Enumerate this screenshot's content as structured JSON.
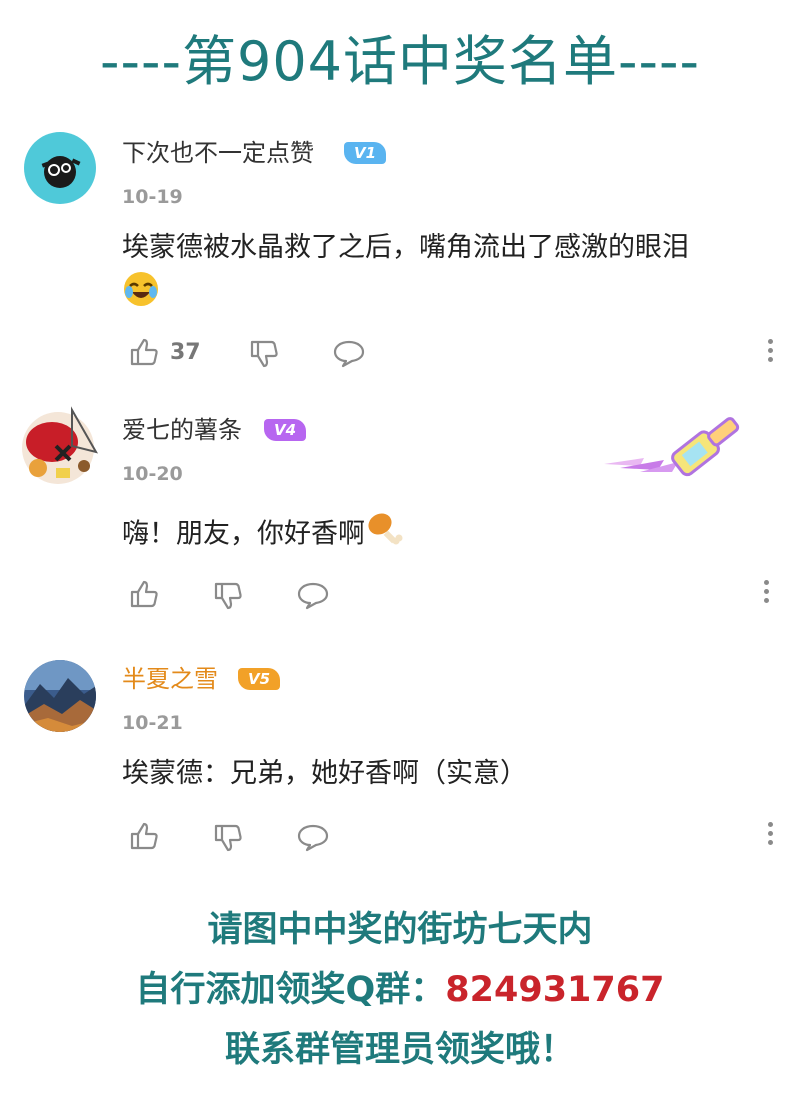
{
  "header": {
    "title": "----第904话中奖名单----"
  },
  "comments": [
    {
      "username": "下次也不一定点赞",
      "level": "V1",
      "level_color": "#5ab4f0",
      "date": "10-19",
      "content": "埃蒙德被水晶救了之后，嘴角流出了感激的眼泪",
      "emoji": "laughing-crying-emoji",
      "like_count": "37"
    },
    {
      "username": "爱七的薯条",
      "level": "V4",
      "level_color": "#b766f0",
      "date": "10-20",
      "content": "嗨！朋友，你好香啊",
      "emoji": "drumstick-emoji",
      "decoration": "paintbrush-sticker"
    },
    {
      "username": "半夏之雪",
      "level": "V5",
      "level_color": "#f2a128",
      "username_color": "#e38a1a",
      "date": "10-21",
      "content": "埃蒙德：兄弟，她好香啊（实意）"
    }
  ],
  "footer": {
    "line1": "请图中中奖的街坊七天内",
    "line2_prefix": "自行添加领奖Q群：",
    "line2_number": "824931767",
    "line3": "联系群管理员领奖哦！",
    "accent_color": "#1f7a7c",
    "number_color": "#c9242b"
  }
}
